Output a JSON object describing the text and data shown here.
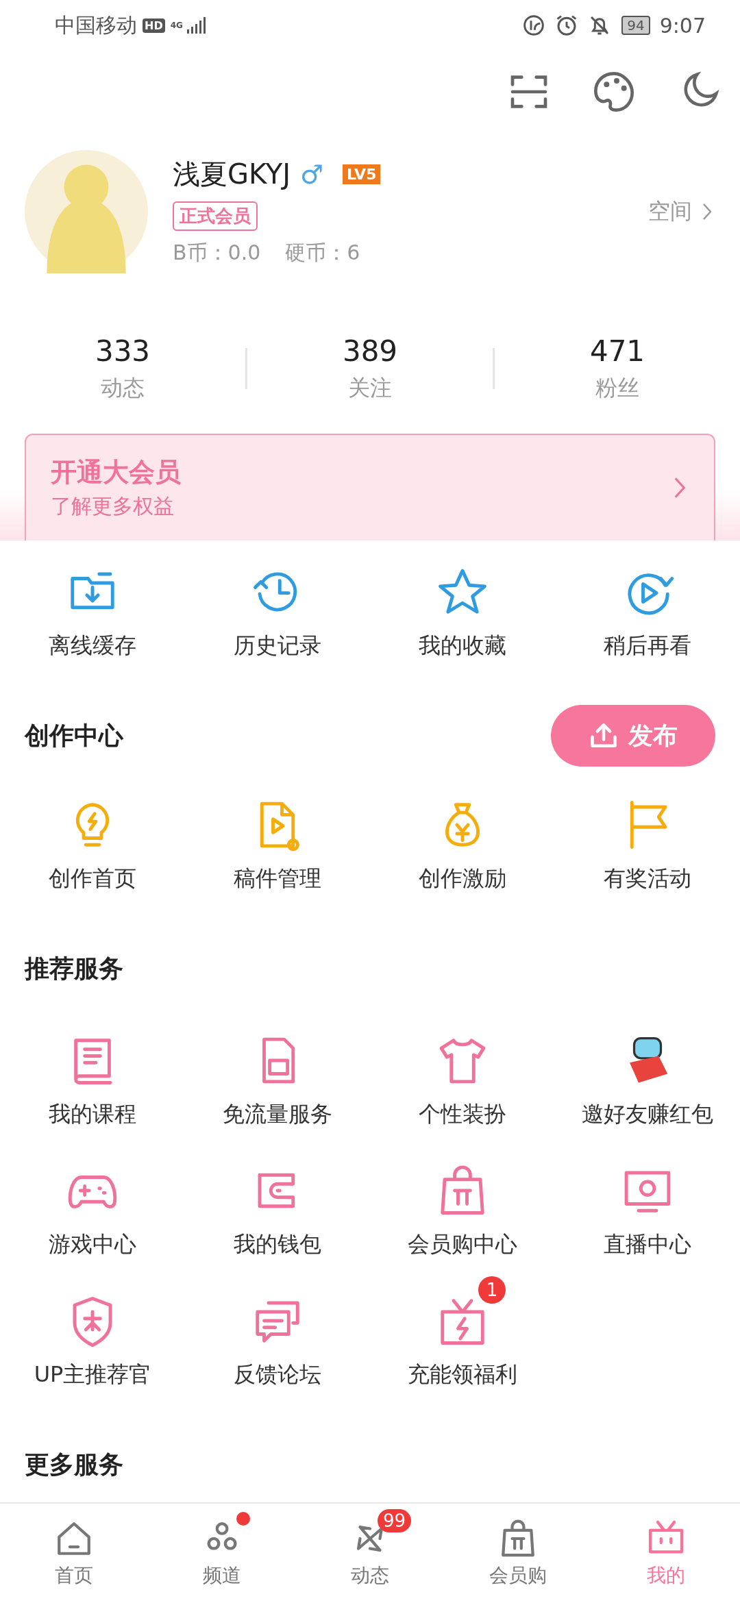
{
  "status_bar": {
    "carrier": "中国移动",
    "hd": "HD",
    "network": "4G",
    "battery": "94",
    "time": "9:07"
  },
  "profile": {
    "name": "浅夏GKYJ",
    "gender": "♂",
    "level": "LV5",
    "member_tag": "正式会员",
    "space_link": "空间",
    "b_coins": "B币：0.0",
    "coins": "硬币：6"
  },
  "stats": [
    {
      "value": "333",
      "label": "动态"
    },
    {
      "value": "389",
      "label": "关注"
    },
    {
      "value": "471",
      "label": "粉丝"
    }
  ],
  "vip_banner": {
    "title": "开通大会员",
    "subtitle": "了解更多权益"
  },
  "quick_actions": [
    {
      "label": "离线缓存"
    },
    {
      "label": "历史记录"
    },
    {
      "label": "我的收藏"
    },
    {
      "label": "稍后再看"
    }
  ],
  "creation_center": {
    "title": "创作中心",
    "publish_button": "发布",
    "items": [
      {
        "label": "创作首页"
      },
      {
        "label": "稿件管理"
      },
      {
        "label": "创作激励"
      },
      {
        "label": "有奖活动"
      }
    ]
  },
  "recommended_services": {
    "title": "推荐服务",
    "items": [
      {
        "label": "我的课程"
      },
      {
        "label": "免流量服务"
      },
      {
        "label": "个性装扮"
      },
      {
        "label": "邀好友赚红包"
      },
      {
        "label": "游戏中心"
      },
      {
        "label": "我的钱包"
      },
      {
        "label": "会员购中心"
      },
      {
        "label": "直播中心"
      },
      {
        "label": "UP主推荐官"
      },
      {
        "label": "反馈论坛"
      },
      {
        "label": "充能领福利",
        "badge": "1"
      }
    ]
  },
  "more_services": {
    "title": "更多服务"
  },
  "tab_bar": [
    {
      "label": "首页",
      "selected": false,
      "dot": false
    },
    {
      "label": "频道",
      "selected": false,
      "dot": true
    },
    {
      "label": "动态",
      "selected": false,
      "dot": false,
      "badge": "99"
    },
    {
      "label": "会员购",
      "selected": false,
      "dot": false
    },
    {
      "label": "我的",
      "selected": true,
      "dot": false
    }
  ]
}
